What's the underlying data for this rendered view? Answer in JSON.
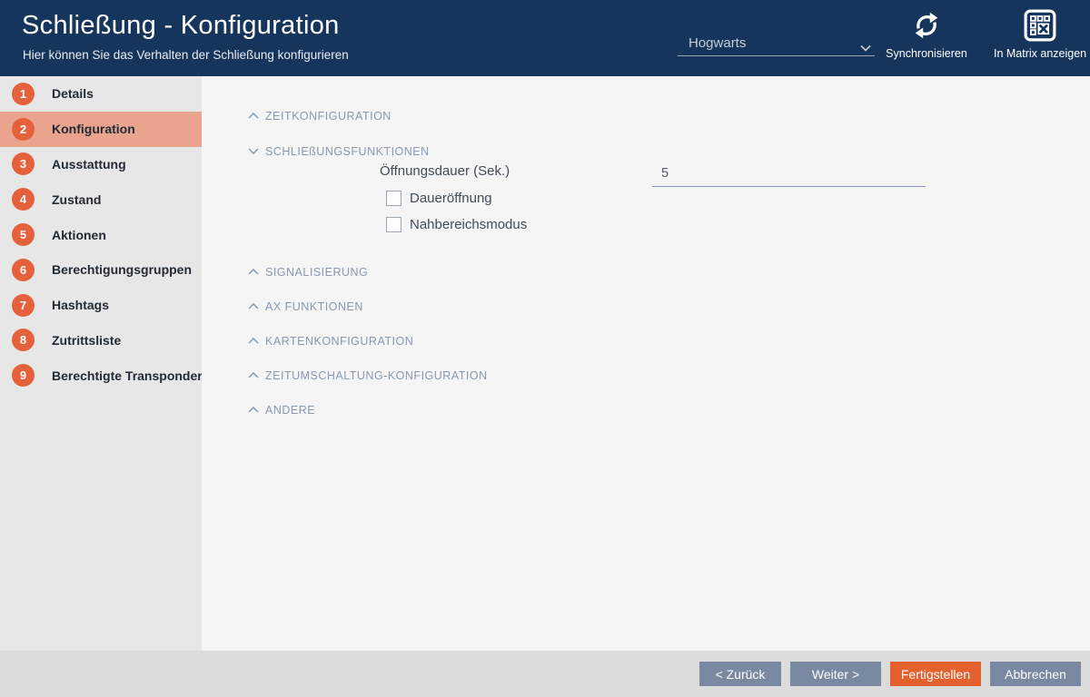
{
  "header": {
    "title": "Schließung - Konfiguration",
    "subtitle": "Hier können Sie das Verhalten der Schließung konfigurieren",
    "locking_system_selector": {
      "value": "Hogwarts"
    },
    "actions": {
      "sync": {
        "label": "Synchronisieren",
        "icon": "sync-icon"
      },
      "matrix": {
        "label": "In Matrix anzeigen",
        "icon": "matrix-grid-icon"
      }
    },
    "background_color": "#16355C"
  },
  "sidebar": {
    "active_step": 2,
    "items": [
      {
        "number": "1",
        "label": "Details"
      },
      {
        "number": "2",
        "label": "Konfiguration"
      },
      {
        "number": "3",
        "label": "Ausstattung"
      },
      {
        "number": "4",
        "label": "Zustand"
      },
      {
        "number": "5",
        "label": "Aktionen"
      },
      {
        "number": "6",
        "label": "Berechtigungsgruppen"
      },
      {
        "number": "7",
        "label": "Hashtags"
      },
      {
        "number": "8",
        "label": "Zutrittsliste"
      },
      {
        "number": "9",
        "label": "Berechtigte Transponder"
      }
    ],
    "step_circle_color": "#E5613C",
    "active_row_color": "#EAA48E"
  },
  "content": {
    "sections": [
      {
        "label": "ZEITKONFIGURATION",
        "expanded": false
      },
      {
        "label": "SCHLIEßUNGSFUNKTIONEN",
        "expanded": true
      },
      {
        "label": "SIGNALISIERUNG",
        "expanded": false
      },
      {
        "label": "AX FUNKTIONEN",
        "expanded": false
      },
      {
        "label": "KARTENKONFIGURATION",
        "expanded": false
      },
      {
        "label": "ZEITUMSCHALTUNG-KONFIGURATION",
        "expanded": false
      },
      {
        "label": "ANDERE",
        "expanded": false
      }
    ],
    "form": {
      "opening_duration_label": "Öffnungsdauer (Sek.)",
      "opening_duration_value": "5",
      "checkboxes": [
        {
          "label": "Daueröffnung",
          "checked": false
        },
        {
          "label": "Nahbereichsmodus",
          "checked": false
        }
      ]
    },
    "section_header_color": "#8599B1"
  },
  "footer": {
    "buttons": {
      "back": {
        "label": "< Zurück"
      },
      "next": {
        "label": "Weiter >"
      },
      "finish": {
        "label": "Fertigstellen",
        "color": "#E4612E"
      },
      "cancel": {
        "label": "Abbrechen"
      }
    },
    "secondary_button_color": "#7889A1"
  }
}
